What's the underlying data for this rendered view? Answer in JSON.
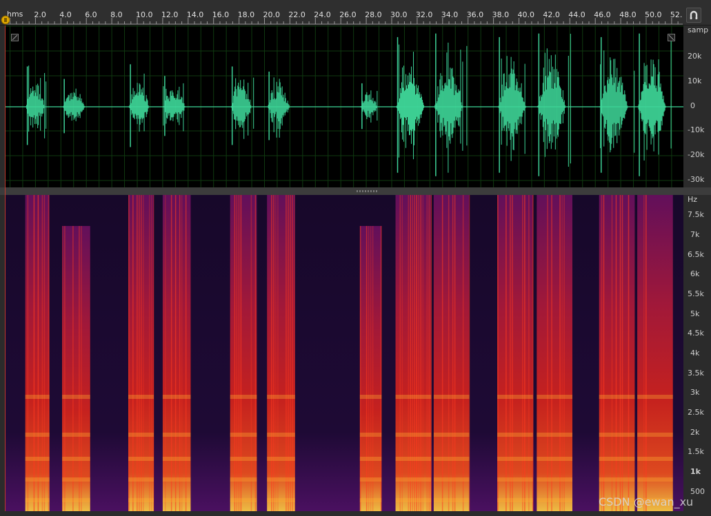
{
  "timeline": {
    "unit_label": "hms",
    "ticks": [
      "2.0",
      "4.0",
      "6.0",
      "8.0",
      "10.0",
      "12.0",
      "14.0",
      "16.0",
      "18.0",
      "20.0",
      "22.0",
      "24.0",
      "26.0",
      "28.0",
      "30.0",
      "32.0",
      "34.0",
      "36.0",
      "38.0",
      "40.0",
      "42.0",
      "44.0",
      "46.0",
      "48.0",
      "50.0",
      "52.0"
    ]
  },
  "waveform": {
    "unit_label": "samp",
    "ticks": [
      "20k",
      "10k",
      "0",
      "-10k",
      "-20k",
      "-30k"
    ],
    "color": "#3ed598",
    "bursts": [
      {
        "start": 1.2,
        "end": 3.1,
        "amp": 0.55
      },
      {
        "start": 4.1,
        "end": 6.3,
        "amp": 0.38
      },
      {
        "start": 9.3,
        "end": 11.3,
        "amp": 0.58
      },
      {
        "start": 12.0,
        "end": 14.2,
        "amp": 0.42
      },
      {
        "start": 17.3,
        "end": 19.4,
        "amp": 0.55
      },
      {
        "start": 20.2,
        "end": 22.4,
        "amp": 0.48
      },
      {
        "start": 27.5,
        "end": 29.2,
        "amp": 0.32
      },
      {
        "start": 30.3,
        "end": 33.1,
        "amp": 0.95
      },
      {
        "start": 33.3,
        "end": 36.1,
        "amp": 1.0
      },
      {
        "start": 38.3,
        "end": 41.1,
        "amp": 0.95
      },
      {
        "start": 41.4,
        "end": 44.2,
        "amp": 1.0
      },
      {
        "start": 46.3,
        "end": 49.1,
        "amp": 0.95
      },
      {
        "start": 49.3,
        "end": 52.1,
        "amp": 1.0
      }
    ]
  },
  "spectrogram": {
    "unit_label": "Hz",
    "ticks": [
      "7.5k",
      "7k",
      "6.5k",
      "6k",
      "5.5k",
      "5k",
      "4.5k",
      "4k",
      "3.5k",
      "3k",
      "2.5k",
      "2k",
      "1.5k",
      "1k",
      "500"
    ]
  },
  "watermark": "CSDN @ewan_xu"
}
